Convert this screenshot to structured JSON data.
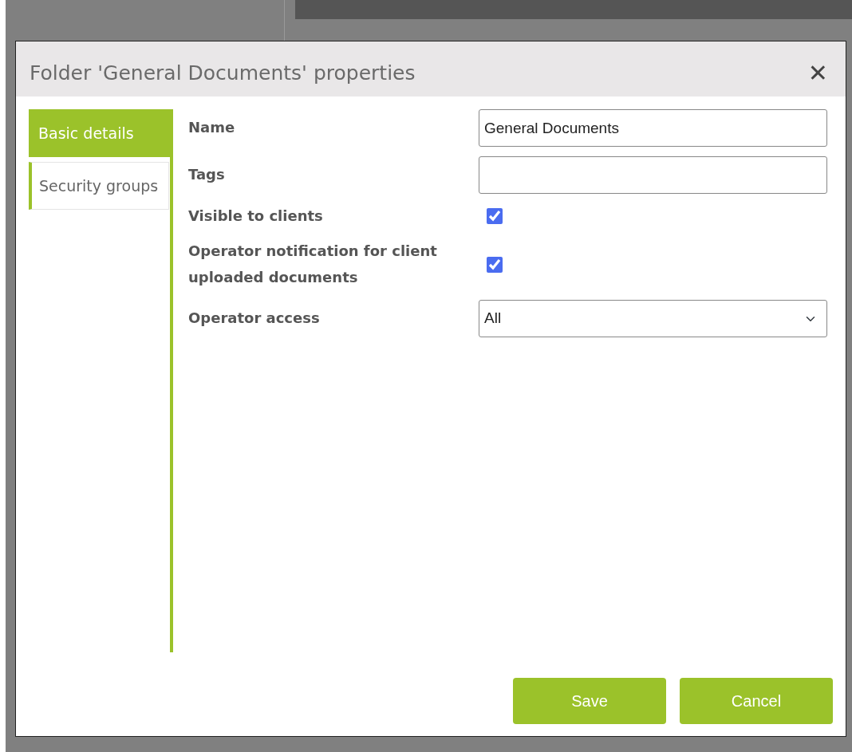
{
  "dialog": {
    "title": "Folder 'General Documents' properties",
    "close": "✕"
  },
  "tabs": [
    {
      "label": "Basic details",
      "selected": true
    },
    {
      "label": "Security groups",
      "selected": false
    }
  ],
  "fields": [
    {
      "kind": "text",
      "label": "Name",
      "value": "General Documents"
    },
    {
      "kind": "text",
      "label": "Tags"
    },
    {
      "kind": "checkbox",
      "label": "Visible to clients",
      "checked": true
    },
    {
      "kind": "checkbox",
      "label": "Operator notification for client uploaded documents",
      "checked": true
    },
    {
      "kind": "select",
      "label": "Operator access",
      "value": "All"
    }
  ],
  "buttons": [
    "Save",
    "Cancel"
  ]
}
